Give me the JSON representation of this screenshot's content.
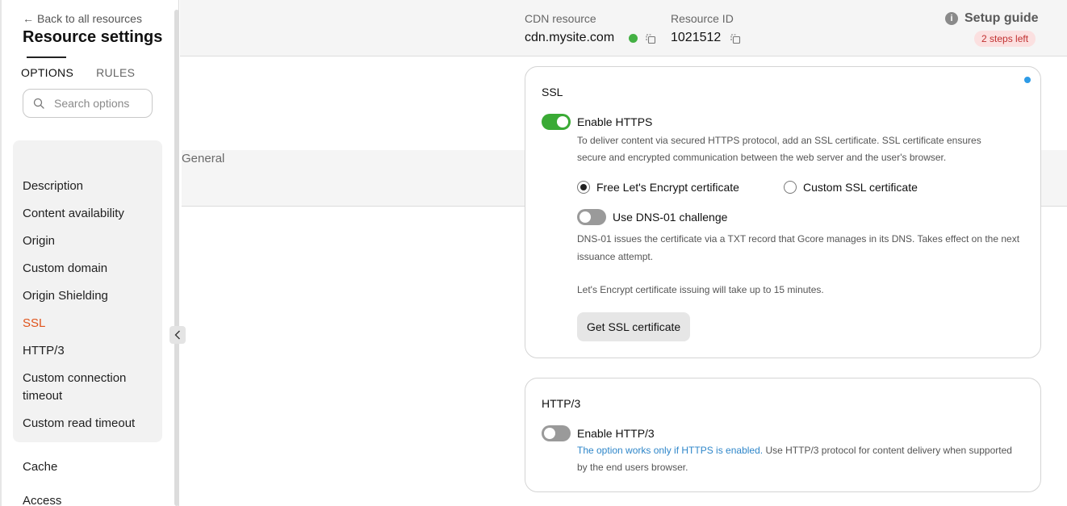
{
  "sidebar": {
    "back_label": "Back to all resources",
    "title": "Resource settings",
    "tabs": [
      {
        "label": "OPTIONS"
      },
      {
        "label": "RULES"
      }
    ],
    "search_placeholder": "Search options",
    "group_header": "General",
    "items": [
      {
        "label": "Description"
      },
      {
        "label": "Content availability"
      },
      {
        "label": "Origin"
      },
      {
        "label": "Custom domain"
      },
      {
        "label": "Origin Shielding"
      },
      {
        "label": "SSL"
      },
      {
        "label": "HTTP/3"
      },
      {
        "label": "Custom connection timeout"
      },
      {
        "label": "Custom read timeout"
      }
    ],
    "sections": [
      {
        "label": "Cache"
      },
      {
        "label": "Access"
      }
    ],
    "active_color": "#e0531b"
  },
  "header": {
    "cdn_label": "CDN resource",
    "cdn_value": "cdn.mysite.com",
    "id_label": "Resource ID",
    "id_value": "1021512",
    "status_color": "#43b043",
    "setup_guide_label": "Setup guide",
    "steps_badge": "2 steps left"
  },
  "ssl": {
    "title": "SSL",
    "enable_label": "Enable HTTPS",
    "enable_desc": "To deliver content via secured HTTPS protocol, add an SSL certificate. SSL certificate ensures secure and encrypted communication between the web server and the user's browser.",
    "radio_free": "Free Let's Encrypt certificate",
    "radio_custom": "Custom SSL certificate",
    "dns_label": "Use DNS-01 challenge",
    "dns_desc": "DNS-01 issues the certificate via a TXT record that Gcore manages in its DNS. Takes effect on the next issuance attempt.",
    "issue_note": "Let's Encrypt certificate issuing will take up to 15 minutes.",
    "get_button": "Get SSL certificate"
  },
  "http3": {
    "title": "HTTP/3",
    "enable_label": "Enable HTTP/3",
    "desc_link": "The option works only if HTTPS is enabled.",
    "desc_rest": " Use HTTP/3 protocol for content delivery when supported by the end users browser."
  }
}
